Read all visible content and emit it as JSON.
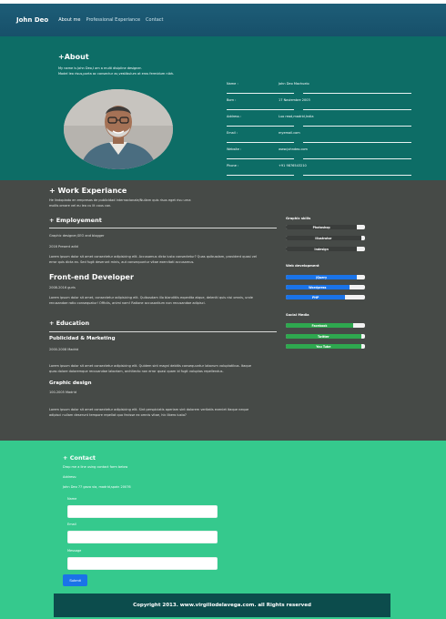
{
  "nav": {
    "brand": "John Deo",
    "links": [
      "About me",
      "Professional Experiance",
      "Contact"
    ]
  },
  "about": {
    "heading": "+About",
    "intro_line1": "My name is John Deo,I am a multi disipline designer.",
    "intro_line2": "Model leo risus,porta ac consectur ac,vestibulum at eros fermidum nibh.",
    "info": [
      {
        "key": "Name :",
        "value": "John Deo Machuelo"
      },
      {
        "key": "Born :",
        "value": "17 Noviembre 2003"
      },
      {
        "key": "Address :",
        "value": "Luo read,madrid,India"
      },
      {
        "key": "Email :",
        "value": "myemail.com"
      },
      {
        "key": "Website :",
        "value": "www.johndeo.com"
      },
      {
        "key": "Phone :",
        "value": "+91 9876543210"
      }
    ]
  },
  "work": {
    "heading": "+ Work Experiance",
    "intro_line1": "He lindoplado en empresas de publicidad internacionale/Nullam quis risus eget risu urna",
    "intro_line2": "mollis ornare vel eu leo cu lit cous con.",
    "employment_heading": "+ Employement",
    "job1_title": "Graphic designer,SEO and blogger",
    "job1_date": "2016 Present adid",
    "job1_text_1": "Lorem ipsum dolor sit amet consectetur adipisicing elit. Accusamus dicta iusto consectetur? Quas quibusdam, provident quasi vel",
    "job1_text_2": "error quis dicta ex. Sed fugit deserunt minis, aut consequuntur vitae exercitati accusamus.",
    "job2_title": "Front-end Developer",
    "job2_date": "2008-2016 guris",
    "job2_text_1": "Lorem ipsum dolor sit amet, consectetur adipisicing elit. Quibusdam illo blanditiis expedita atque, deleniti quis nisi omnis, unde",
    "job2_text_2": "recusandae ratio consequatur! Officiis, animi nam! Ratione accusantium non recusandae adipisci.",
    "education_heading": "+ Education",
    "edu1_title": "Publicidad & Marketing",
    "edu1_date": "2000-2008 Madrid",
    "edu1_text_1": "Lorem ipsum dolor sit amet consectetur adipisicing elit. Quidem sint magni debitis consequuntur laborum voluptatibus. Itaque",
    "edu1_text_2": "quas dolore doloremque recusandae laboriam, architecto non error quasi quam id fugit voluptas repellendus.",
    "edu2_title": "Graphic design",
    "edu2_date": "100-2005 Madrid",
    "edu2_text_1": "Lorem ipsum dolor sit amet consectetur adipisicing elit. Sint perspiciatis aperiam sint dolorem veritatis eveniet itaque neque",
    "edu2_text_2": "adipisci nullam deserunt tempore repellat quo fecisse ex omnis vitae, hic libero iusto?"
  },
  "skills": {
    "graphic_title": "Graphic skills",
    "graphic": [
      {
        "label": "Photoshop",
        "level": 0.9
      },
      {
        "label": "Illustrator",
        "level": 0.95
      },
      {
        "label": "Indesign",
        "level": 0.9
      }
    ],
    "web_title": "Web development",
    "web": [
      {
        "label": "jQuery",
        "level": 0.9
      },
      {
        "label": "Wordpress",
        "level": 0.8
      },
      {
        "label": "PHP",
        "level": 0.75
      }
    ],
    "social_title": "Social Media",
    "social": [
      {
        "label": "Facebook",
        "level": 0.85
      },
      {
        "label": "Twitter",
        "level": 0.95
      },
      {
        "label": "You Tube",
        "level": 0.95
      }
    ],
    "colors": {
      "graphic": "#3a3d3b",
      "web": "#1a73e8",
      "social": "#2ea84f"
    }
  },
  "contact": {
    "heading": "+ Contact",
    "subheading": "Drop me a line using contact form below",
    "address_label": "Address:",
    "address": "John Deo 77 gavo via, madrid,spain 20076",
    "name_label": "Name",
    "email_label": "Email",
    "message_label": "Message",
    "submit_label": "Submit"
  },
  "footer": {
    "text": "Copyright 2013. www.virgiliodelavega.com. all Rights reserved"
  }
}
